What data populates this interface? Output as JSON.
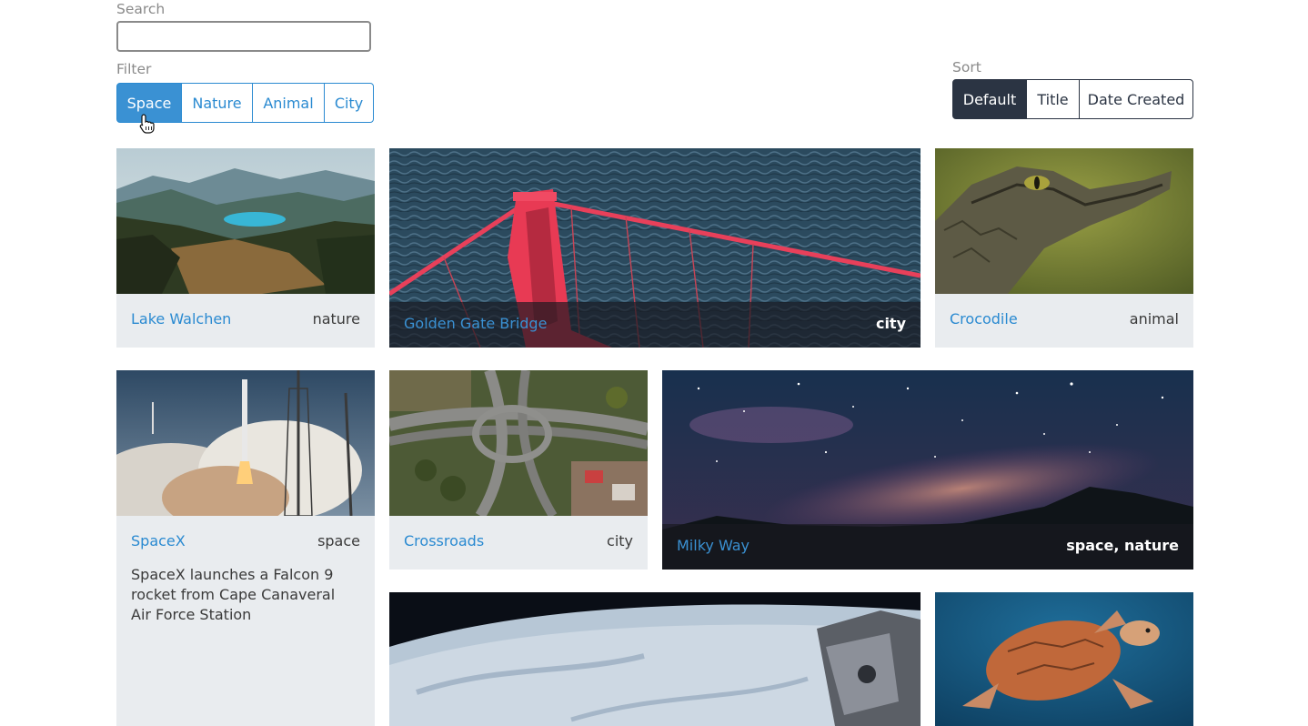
{
  "search": {
    "label": "Search",
    "value": "",
    "placeholder": ""
  },
  "filter": {
    "label": "Filter",
    "options": [
      "Space",
      "Nature",
      "Animal",
      "City"
    ],
    "active": "Space"
  },
  "sort": {
    "label": "Sort",
    "options": [
      "Default",
      "Title",
      "Date Created"
    ],
    "active": "Default"
  },
  "cards": [
    {
      "title": "Lake Walchen",
      "tag": "nature",
      "description": ""
    },
    {
      "title": "Golden Gate Bridge",
      "tag": "city",
      "description": ""
    },
    {
      "title": "Crocodile",
      "tag": "animal",
      "description": ""
    },
    {
      "title": "SpaceX",
      "tag": "space",
      "description": "SpaceX launches a Falcon 9 rocket from Cape Canaveral Air Force Station"
    },
    {
      "title": "Crossroads",
      "tag": "city",
      "description": ""
    },
    {
      "title": "Milky Way",
      "tag": "space, nature",
      "description": ""
    },
    {
      "title": "",
      "tag": "",
      "description": ""
    },
    {
      "title": "",
      "tag": "",
      "description": ""
    }
  ],
  "colors": {
    "accent": "#3a91d3",
    "sort_active": "#2b3443",
    "card_bg": "#e9ecef"
  },
  "icons": {
    "cursor": "hand-pointer-icon"
  }
}
